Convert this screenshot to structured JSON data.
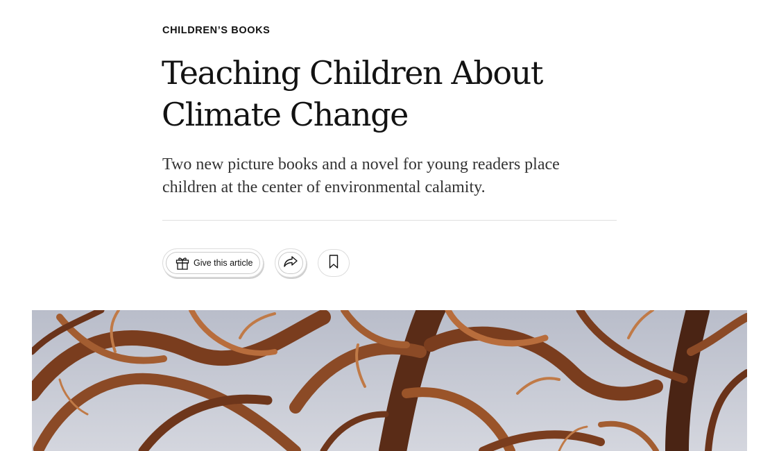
{
  "article": {
    "kicker": "CHILDREN’S BOOKS",
    "headline": "Teaching Children About Climate Change",
    "summary": "Two new picture books and a novel for young readers place children at the center of environmental calamity."
  },
  "actions": {
    "gift_label": "Give this article",
    "gift_icon": "gift-icon",
    "share_icon": "share-icon",
    "save_icon": "bookmark-icon"
  },
  "image": {
    "subject": "illustration-branches",
    "colors": {
      "sky": "#c5c9d4",
      "branch_dark": "#5a2c17",
      "branch_mid": "#8b4a26",
      "branch_light": "#b86d3c"
    }
  }
}
